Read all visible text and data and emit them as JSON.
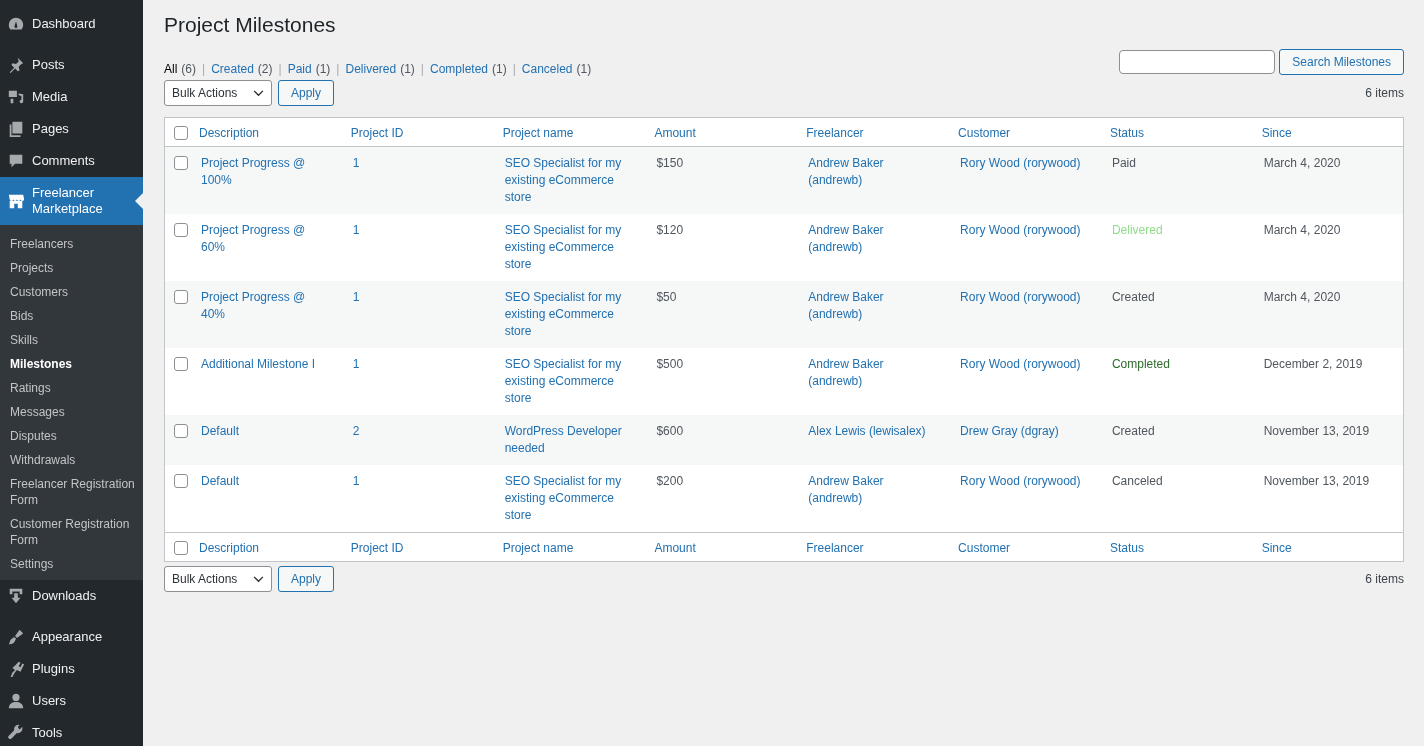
{
  "sidebar": {
    "groups": [
      {
        "items": [
          {
            "label": "Dashboard",
            "selected": false
          }
        ]
      },
      {
        "items": [
          {
            "label": "Posts",
            "selected": false
          },
          {
            "label": "Media",
            "selected": false
          },
          {
            "label": "Pages",
            "selected": false
          },
          {
            "label": "Comments",
            "selected": false
          },
          {
            "label": "Freelancer Marketplace",
            "selected": true,
            "expanded": true,
            "children": [
              {
                "label": "Freelancers",
                "selected": false
              },
              {
                "label": "Projects",
                "selected": false
              },
              {
                "label": "Customers",
                "selected": false
              },
              {
                "label": "Bids",
                "selected": false
              },
              {
                "label": "Skills",
                "selected": false
              },
              {
                "label": "Milestones",
                "selected": true
              },
              {
                "label": "Ratings",
                "selected": false
              },
              {
                "label": "Messages",
                "selected": false
              },
              {
                "label": "Disputes",
                "selected": false
              },
              {
                "label": "Withdrawals",
                "selected": false
              },
              {
                "label": "Freelancer Registration Form",
                "selected": false
              },
              {
                "label": "Customer Registration Form",
                "selected": false
              },
              {
                "label": "Settings",
                "selected": false
              }
            ]
          },
          {
            "label": "Downloads",
            "selected": false
          }
        ]
      },
      {
        "items": [
          {
            "label": "Appearance",
            "selected": false
          },
          {
            "label": "Plugins",
            "selected": false
          },
          {
            "label": "Users",
            "selected": false
          },
          {
            "label": "Tools",
            "selected": false
          }
        ]
      }
    ]
  },
  "page_title": "Project Milestones",
  "filters": [
    {
      "label": "All",
      "count": "(6)",
      "selected": true
    },
    {
      "label": "Created",
      "count": "(2)",
      "selected": false
    },
    {
      "label": "Paid",
      "count": "(1)",
      "selected": false
    },
    {
      "label": "Delivered",
      "count": "(1)",
      "selected": false
    },
    {
      "label": "Completed",
      "count": "(1)",
      "selected": false
    },
    {
      "label": "Canceled",
      "count": "(1)",
      "selected": false
    }
  ],
  "filter_separator": "|",
  "search": {
    "button": "Search Milestones"
  },
  "top_actions": {
    "bulk": "Bulk Actions",
    "apply": "Apply",
    "count": "6 items"
  },
  "bottom_actions": {
    "bulk": "Bulk Actions",
    "apply": "Apply",
    "count": "6 items"
  },
  "table": {
    "header_checked": false,
    "footer_checked": false,
    "columns": [
      "Description",
      "Project ID",
      "Project name",
      "Amount",
      "Freelancer",
      "Customer",
      "Status",
      "Since"
    ],
    "footer_columns": [
      "Description",
      "Project ID",
      "Project name",
      "Amount",
      "Freelancer",
      "Customer",
      "Status",
      "Since"
    ],
    "rows": [
      {
        "checked": false,
        "description": "Project Progress @ 100%",
        "project_id": "1",
        "project_name": "SEO Specialist for my existing eCommerce store",
        "amount": "$150",
        "freelancer": "Andrew Baker (andrewb)",
        "customer": "Rory Wood (rorywood)",
        "status": "Paid",
        "color": "#50575e",
        "since": "March 4, 2020"
      },
      {
        "checked": false,
        "description": "Project Progress @ 60%",
        "project_id": "1",
        "project_name": "SEO Specialist for my existing eCommerce store",
        "amount": "$120",
        "freelancer": "Andrew Baker (andrewb)",
        "customer": "Rory Wood (rorywood)",
        "status": "Delivered",
        "color": "#8fdc8a",
        "since": "March 4, 2020"
      },
      {
        "checked": false,
        "description": "Project Progress @ 40%",
        "project_id": "1",
        "project_name": "SEO Specialist for my existing eCommerce store",
        "amount": "$50",
        "freelancer": "Andrew Baker (andrewb)",
        "customer": "Rory Wood (rorywood)",
        "status": "Created",
        "color": "#50575e",
        "since": "March 4, 2020"
      },
      {
        "checked": false,
        "description": "Additional Milestone I",
        "project_id": "1",
        "project_name": "SEO Specialist for my existing eCommerce store",
        "amount": "$500",
        "freelancer": "Andrew Baker (andrewb)",
        "customer": "Rory Wood (rorywood)",
        "status": "Completed",
        "color": "#2e6b2a",
        "since": "December 2, 2019"
      },
      {
        "checked": false,
        "description": "Default",
        "project_id": "2",
        "project_name": "WordPress Developer needed",
        "amount": "$600",
        "freelancer": "Alex Lewis (lewisalex)",
        "customer": "Drew Gray (dgray)",
        "status": "Created",
        "color": "#50575e",
        "since": "November 13, 2019"
      },
      {
        "checked": false,
        "description": "Default",
        "project_id": "1",
        "project_name": "SEO Specialist for my existing eCommerce store",
        "amount": "$200",
        "freelancer": "Andrew Baker (andrewb)",
        "customer": "Rory Wood (rorywood)",
        "status": "Canceled",
        "color": "#50575e",
        "since": "November 13, 2019"
      }
    ]
  }
}
